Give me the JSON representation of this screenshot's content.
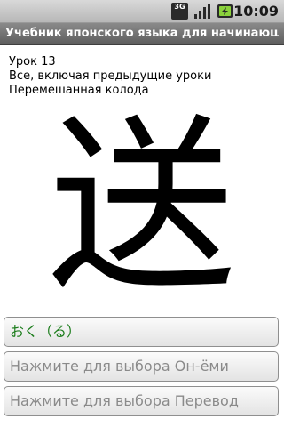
{
  "status_bar": {
    "network_label": "3G",
    "time": "10:09",
    "icons": [
      "3g-icon",
      "signal-icon",
      "battery-charging-icon"
    ]
  },
  "title_bar": {
    "title": "Учебник японского языка для начинающ..."
  },
  "lesson_info": {
    "lesson": "Урок 13",
    "scope": "Все, включая предыдущие уроки",
    "deck": "Перемешанная колода"
  },
  "card": {
    "kanji": "送"
  },
  "answers": {
    "reading": "おく（る）",
    "onyomi_prompt": "Нажмите для выбора Он-ёми",
    "translation_prompt": "Нажмите для выбора Перевод"
  },
  "colors": {
    "reading_text": "#1c7d1c",
    "prompt_text": "#8a8a8a",
    "title_bar": "#6f6f6f"
  }
}
